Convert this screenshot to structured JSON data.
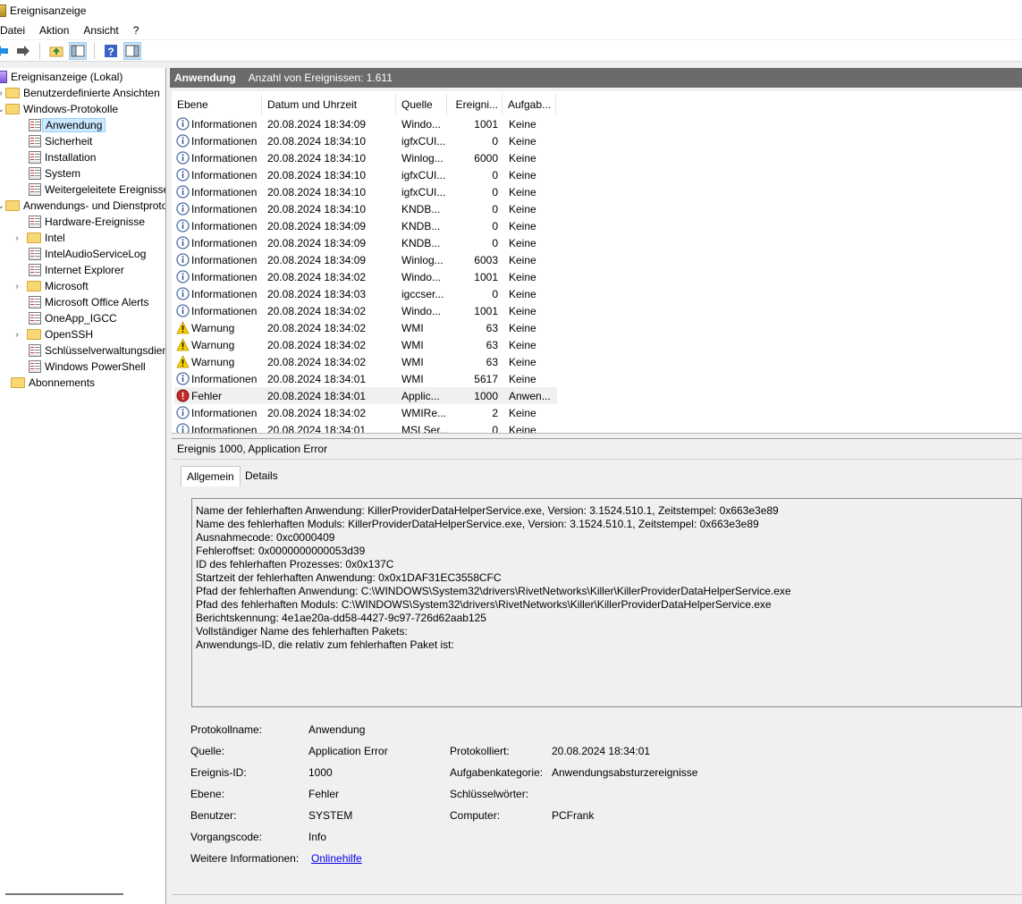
{
  "window": {
    "title": "Ereignisanzeige"
  },
  "menu": [
    "Datei",
    "Aktion",
    "Ansicht",
    "?"
  ],
  "tree": {
    "root": "Ereignisanzeige (Lokal)",
    "custom_views": "Benutzerdefinierte Ansichten",
    "windows_logs": "Windows-Protokolle",
    "windows_log_items": [
      "Anwendung",
      "Sicherheit",
      "Installation",
      "System",
      "Weitergeleitete Ereignisse"
    ],
    "app_services": "Anwendungs- und Dienstprotokolle",
    "app_service_items": [
      "Hardware-Ereignisse",
      "Intel",
      "IntelAudioServiceLog",
      "Internet Explorer",
      "Microsoft",
      "Microsoft Office Alerts",
      "OneApp_IGCC",
      "OpenSSH",
      "Schlüsselverwaltungsdienst",
      "Windows PowerShell"
    ],
    "subscriptions": "Abonnements"
  },
  "header": {
    "title": "Anwendung",
    "count": "Anzahl von Ereignissen: 1.611"
  },
  "events": {
    "columns": [
      "Ebene",
      "Datum und Uhrzeit",
      "Quelle",
      "Ereigni...",
      "Aufgab..."
    ],
    "rows": [
      {
        "level": "Informationen",
        "type": "info",
        "date": "20.08.2024 18:34:09",
        "source": "Windo...",
        "id": "1001",
        "task": "Keine"
      },
      {
        "level": "Informationen",
        "type": "info",
        "date": "20.08.2024 18:34:10",
        "source": "igfxCUI...",
        "id": "0",
        "task": "Keine"
      },
      {
        "level": "Informationen",
        "type": "info",
        "date": "20.08.2024 18:34:10",
        "source": "Winlog...",
        "id": "6000",
        "task": "Keine"
      },
      {
        "level": "Informationen",
        "type": "info",
        "date": "20.08.2024 18:34:10",
        "source": "igfxCUI...",
        "id": "0",
        "task": "Keine"
      },
      {
        "level": "Informationen",
        "type": "info",
        "date": "20.08.2024 18:34:10",
        "source": "igfxCUI...",
        "id": "0",
        "task": "Keine"
      },
      {
        "level": "Informationen",
        "type": "info",
        "date": "20.08.2024 18:34:10",
        "source": "KNDB...",
        "id": "0",
        "task": "Keine"
      },
      {
        "level": "Informationen",
        "type": "info",
        "date": "20.08.2024 18:34:09",
        "source": "KNDB...",
        "id": "0",
        "task": "Keine"
      },
      {
        "level": "Informationen",
        "type": "info",
        "date": "20.08.2024 18:34:09",
        "source": "KNDB...",
        "id": "0",
        "task": "Keine"
      },
      {
        "level": "Informationen",
        "type": "info",
        "date": "20.08.2024 18:34:09",
        "source": "Winlog...",
        "id": "6003",
        "task": "Keine"
      },
      {
        "level": "Informationen",
        "type": "info",
        "date": "20.08.2024 18:34:02",
        "source": "Windo...",
        "id": "1001",
        "task": "Keine"
      },
      {
        "level": "Informationen",
        "type": "info",
        "date": "20.08.2024 18:34:03",
        "source": "igccser...",
        "id": "0",
        "task": "Keine"
      },
      {
        "level": "Informationen",
        "type": "info",
        "date": "20.08.2024 18:34:02",
        "source": "Windo...",
        "id": "1001",
        "task": "Keine"
      },
      {
        "level": "Warnung",
        "type": "warn",
        "date": "20.08.2024 18:34:02",
        "source": "WMI",
        "id": "63",
        "task": "Keine"
      },
      {
        "level": "Warnung",
        "type": "warn",
        "date": "20.08.2024 18:34:02",
        "source": "WMI",
        "id": "63",
        "task": "Keine"
      },
      {
        "level": "Warnung",
        "type": "warn",
        "date": "20.08.2024 18:34:02",
        "source": "WMI",
        "id": "63",
        "task": "Keine"
      },
      {
        "level": "Informationen",
        "type": "info",
        "date": "20.08.2024 18:34:01",
        "source": "WMI",
        "id": "5617",
        "task": "Keine"
      },
      {
        "level": "Fehler",
        "type": "error",
        "date": "20.08.2024 18:34:01",
        "source": "Applic...",
        "id": "1000",
        "task": "Anwen...",
        "selected": true
      },
      {
        "level": "Informationen",
        "type": "info",
        "date": "20.08.2024 18:34:02",
        "source": "WMIRe...",
        "id": "2",
        "task": "Keine"
      },
      {
        "level": "Informationen",
        "type": "info",
        "date": "20.08.2024 18:34:01",
        "source": "MSI Ser...",
        "id": "0",
        "task": "Keine"
      }
    ]
  },
  "detail": {
    "title": "Ereignis 1000, Application Error",
    "tabs": [
      "Allgemein",
      "Details"
    ],
    "description": [
      "Name der fehlerhaften Anwendung: KillerProviderDataHelperService.exe, Version: 3.1524.510.1, Zeitstempel: 0x663e3e89",
      "Name des fehlerhaften Moduls: KillerProviderDataHelperService.exe, Version: 3.1524.510.1, Zeitstempel: 0x663e3e89",
      "Ausnahmecode: 0xc0000409",
      "Fehleroffset: 0x0000000000053d39",
      "ID des fehlerhaften Prozesses: 0x0x137C",
      "Startzeit der fehlerhaften Anwendung: 0x0x1DAF31EC3558CFC",
      "Pfad der fehlerhaften Anwendung: C:\\WINDOWS\\System32\\drivers\\RivetNetworks\\Killer\\KillerProviderDataHelperService.exe",
      "Pfad des fehlerhaften Moduls: C:\\WINDOWS\\System32\\drivers\\RivetNetworks\\Killer\\KillerProviderDataHelperService.exe",
      "Berichtskennung: 4e1ae20a-dd58-4427-9c97-726d62aab125",
      "Vollständiger Name des fehlerhaften Pakets:",
      "Anwendungs-ID, die relativ zum fehlerhaften Paket ist:"
    ],
    "props": {
      "log_name_label": "Protokollname:",
      "log_name": "Anwendung",
      "source_label": "Quelle:",
      "source": "Application Error",
      "logged_label": "Protokolliert:",
      "logged": "20.08.2024 18:34:01",
      "event_id_label": "Ereignis-ID:",
      "event_id": "1000",
      "task_cat_label": "Aufgabenkategorie:",
      "task_cat": "Anwendungsabsturzereignisse",
      "level_label": "Ebene:",
      "level": "Fehler",
      "keywords_label": "Schlüsselwörter:",
      "keywords": "",
      "user_label": "Benutzer:",
      "user": "SYSTEM",
      "computer_label": "Computer:",
      "computer": "PCFrank",
      "opcode_label": "Vorgangscode:",
      "opcode": "Info",
      "more_info_label": "Weitere Informationen:",
      "more_info_link": "Onlinehilfe"
    }
  }
}
